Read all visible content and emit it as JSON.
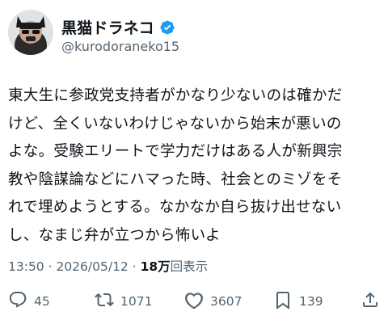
{
  "author": {
    "display_name": "黒猫ドラネコ",
    "handle": "@kurodoraneko15",
    "verified": true,
    "avatar_icon": "black-cat-avatar"
  },
  "tweet": {
    "lines": [
      "東大生に参政党支持者がかなり少ないのは確かだ",
      "けど、全くいないわけじゃないから始末が悪いの",
      "よな。受験エリートで学力だけはある人が新興宗",
      "教や陰謀論などにハマった時、社会とのミゾをそ",
      "れで埋めようとする。なかなか自ら抜け出せない",
      "し、なまじ弁が立つから怖いよ"
    ]
  },
  "meta": {
    "time": "13:50",
    "separator1": " · ",
    "date": "2026/05/12",
    "separator2": " · ",
    "views_count": "18万",
    "views_label": "回表示"
  },
  "actions": {
    "replies": "45",
    "reposts": "1071",
    "likes": "3607",
    "bookmarks": "139"
  },
  "colors": {
    "text": "#0f1419",
    "muted": "#536471",
    "verified": "#1d9bf0"
  }
}
